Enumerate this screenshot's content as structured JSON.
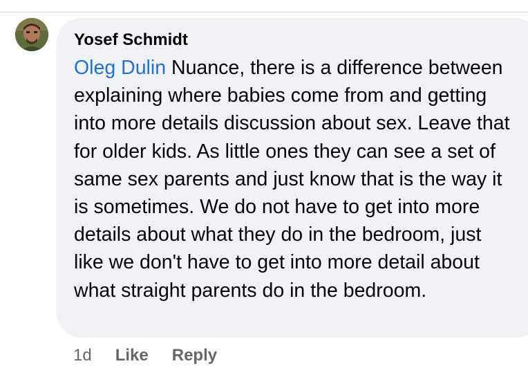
{
  "comment": {
    "author": "Yosef Schmidt",
    "mention": "Oleg Dulin",
    "text": " Nuance, there is a difference between explaining where babies come from and getting into more details discussion about sex.  Leave that for older kids.  As little ones they can see a set of same sex parents and just know that is the way it is sometimes.  We do not have to get into more details about what they do in the bedroom, just like we don't have to get into more detail about what straight parents do in the bedroom.",
    "avatar_icon": "profile-photo"
  },
  "actions": {
    "time": "1d",
    "like_label": "Like",
    "reply_label": "Reply"
  },
  "colors": {
    "bubble_bg": "#f0f2f5",
    "mention": "#216fdb",
    "meta_text": "#65676b"
  }
}
